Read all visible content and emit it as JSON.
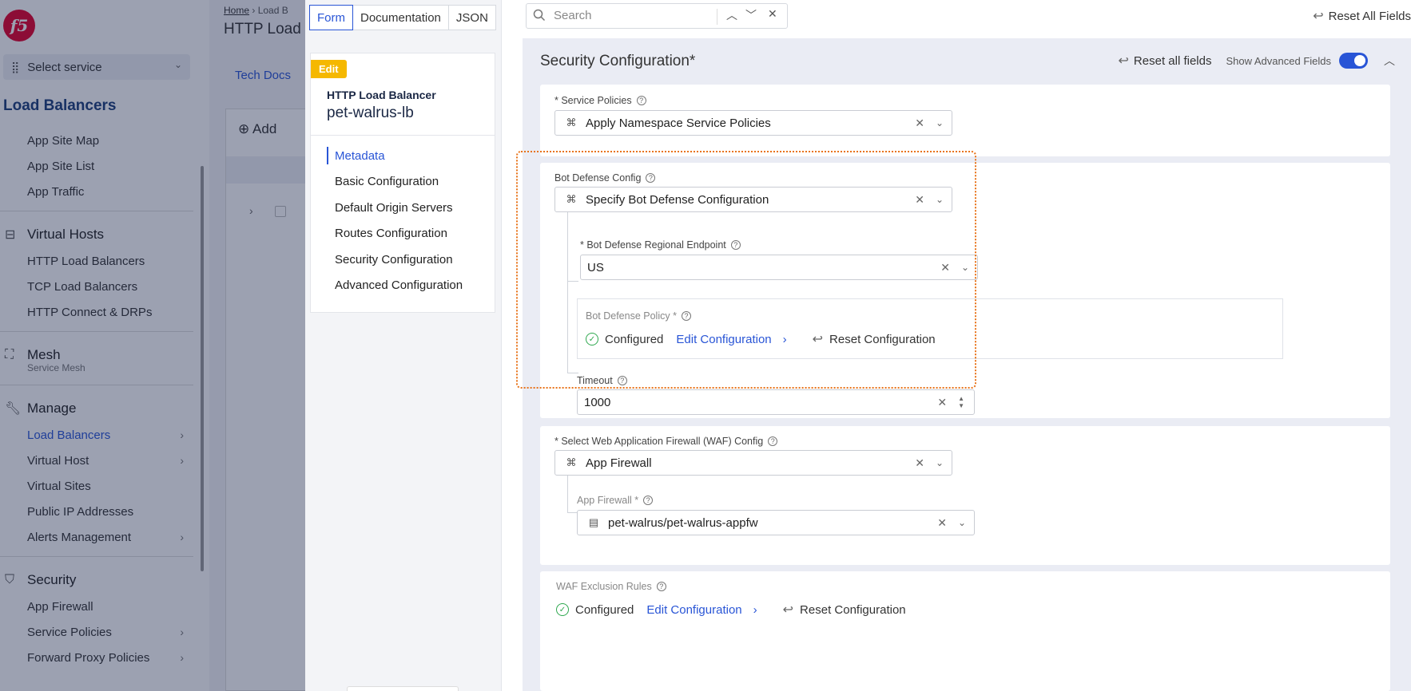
{
  "sidebar": {
    "logo": "f5",
    "select_service": "Select service",
    "title": "Load Balancers",
    "items_top": [
      "App Site Map",
      "App Site List",
      "App Traffic"
    ],
    "virtual_hosts": {
      "label": "Virtual Hosts",
      "items": [
        "HTTP Load Balancers",
        "TCP Load Balancers",
        "HTTP Connect & DRPs"
      ]
    },
    "mesh": {
      "label": "Mesh",
      "sub": "Service Mesh"
    },
    "manage": {
      "label": "Manage",
      "items": [
        "Load Balancers",
        "Virtual Host",
        "Virtual Sites",
        "Public IP Addresses",
        "Alerts Management"
      ]
    },
    "security": {
      "label": "Security",
      "items": [
        "App Firewall",
        "Service Policies",
        "Forward Proxy Policies"
      ]
    }
  },
  "background_page": {
    "breadcrumb_home": "Home",
    "breadcrumb_sep": "›",
    "breadcrumb_next": "Load B",
    "title": "HTTP Load",
    "tech_docs": "Tech Docs",
    "add_label": "Add"
  },
  "drawer": {
    "mode_tabs": [
      "Form",
      "Documentation",
      "JSON"
    ],
    "active_mode": "Form",
    "edit_badge": "Edit",
    "lb_type": "HTTP Load Balancer",
    "lb_name": "pet-walrus-lb",
    "nav": [
      "Metadata",
      "Basic Configuration",
      "Default Origin Servers",
      "Routes Configuration",
      "Security Configuration",
      "Advanced Configuration"
    ],
    "active_nav": "Metadata"
  },
  "topbar": {
    "search_placeholder": "Search",
    "reset_all_fields": "Reset All Fields"
  },
  "section": {
    "title": "Security Configuration*",
    "reset_all_fields": "Reset all fields",
    "show_advanced_fields": "Show Advanced Fields",
    "advanced_enabled": true
  },
  "service_policies": {
    "label": "* Service Policies",
    "value": "Apply Namespace Service Policies"
  },
  "bot_defense": {
    "label": "Bot Defense Config",
    "value": "Specify Bot Defense Configuration",
    "endpoint_label": "* Bot Defense Regional Endpoint",
    "endpoint_value": "US",
    "policy_label": "Bot Defense Policy *",
    "policy_status": "Configured",
    "policy_edit": "Edit Configuration",
    "policy_reset": "Reset Configuration",
    "timeout_label": "Timeout",
    "timeout_value": "1000"
  },
  "waf": {
    "label": "* Select Web Application Firewall (WAF) Config",
    "value": "App Firewall",
    "app_firewall_label": "App Firewall *",
    "app_firewall_value": "pet-walrus/pet-walrus-appfw"
  },
  "waf_exclusion": {
    "label": "WAF Exclusion Rules",
    "status": "Configured",
    "edit": "Edit Configuration",
    "reset": "Reset Configuration"
  },
  "colors": {
    "accent": "#2955d6",
    "edit_badge": "#f5b800",
    "ok": "#2fa84f",
    "highlight": "#e8731a",
    "brand": "#e4002b"
  }
}
